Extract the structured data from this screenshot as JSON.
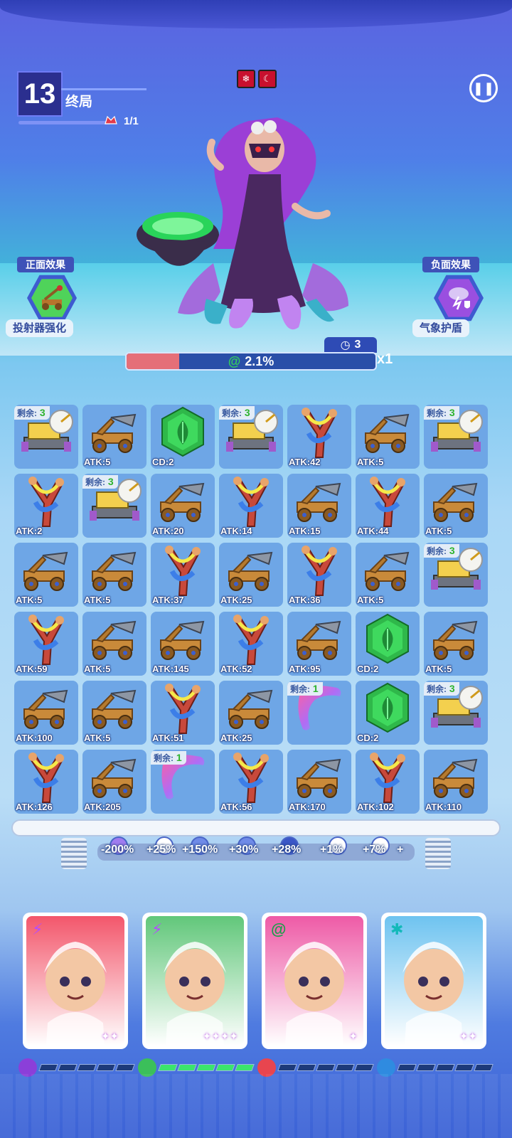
{
  "hud": {
    "level_number": "13",
    "level_title": "终局",
    "wave_text": "1/1",
    "status_icons": [
      "snowflake-icon",
      "sickle-icon"
    ]
  },
  "effects": {
    "positive": {
      "title": "正面效果",
      "label": "投射器强化",
      "icon": "catapult-buff-icon"
    },
    "negative": {
      "title": "负面效果",
      "label": "气象护盾",
      "icon": "storm-shield-icon"
    }
  },
  "boss": {
    "timer": "3",
    "hp_text": "2.1%",
    "hp_fraction": 0.21,
    "multiplier": "x1"
  },
  "grid": [
    [
      {
        "type": "radar",
        "remain": "3"
      },
      {
        "type": "catapult",
        "stat": "ATK:5"
      },
      {
        "type": "gem",
        "stat": "CD:2"
      },
      {
        "type": "radar",
        "remain": "3"
      },
      {
        "type": "slingshot",
        "stat": "ATK:42"
      },
      {
        "type": "catapult",
        "stat": "ATK:5"
      },
      {
        "type": "radar",
        "remain": "3"
      }
    ],
    [
      {
        "type": "slingshot",
        "stat": "ATK:2"
      },
      {
        "type": "radar",
        "remain": "3"
      },
      {
        "type": "catapult",
        "stat": "ATK:20"
      },
      {
        "type": "slingshot",
        "stat": "ATK:14"
      },
      {
        "type": "catapult",
        "stat": "ATK:15"
      },
      {
        "type": "slingshot",
        "stat": "ATK:44"
      },
      {
        "type": "catapult",
        "stat": "ATK:5"
      }
    ],
    [
      {
        "type": "catapult",
        "stat": "ATK:5"
      },
      {
        "type": "catapult",
        "stat": "ATK:5"
      },
      {
        "type": "slingshot",
        "stat": "ATK:37"
      },
      {
        "type": "catapult",
        "stat": "ATK:25"
      },
      {
        "type": "slingshot",
        "stat": "ATK:36"
      },
      {
        "type": "catapult",
        "stat": "ATK:5"
      },
      {
        "type": "radar",
        "remain": "3"
      }
    ],
    [
      {
        "type": "slingshot",
        "stat": "ATK:59"
      },
      {
        "type": "catapult",
        "stat": "ATK:5"
      },
      {
        "type": "catapult",
        "stat": "ATK:145"
      },
      {
        "type": "slingshot",
        "stat": "ATK:52"
      },
      {
        "type": "catapult",
        "stat": "ATK:95"
      },
      {
        "type": "gem",
        "stat": "CD:2"
      },
      {
        "type": "catapult",
        "stat": "ATK:5"
      }
    ],
    [
      {
        "type": "catapult",
        "stat": "ATK:100"
      },
      {
        "type": "catapult",
        "stat": "ATK:5"
      },
      {
        "type": "slingshot",
        "stat": "ATK:51"
      },
      {
        "type": "catapult",
        "stat": "ATK:25"
      },
      {
        "type": "boomerang",
        "remain": "1"
      },
      {
        "type": "gem",
        "stat": "CD:2"
      },
      {
        "type": "radar",
        "remain": "3"
      }
    ],
    [
      {
        "type": "slingshot",
        "stat": "ATK:126"
      },
      {
        "type": "catapult",
        "stat": "ATK:205"
      },
      {
        "type": "boomerang",
        "remain": "1"
      },
      {
        "type": "slingshot",
        "stat": "ATK:56"
      },
      {
        "type": "catapult",
        "stat": "ATK:170"
      },
      {
        "type": "slingshot",
        "stat": "ATK:102"
      },
      {
        "type": "catapult",
        "stat": "ATK:110"
      }
    ]
  ],
  "remain_prefix": "剩余:",
  "buffs": [
    "-200%",
    "+25%",
    "+150%",
    "+30%",
    "+28%",
    "+1%",
    "+7%",
    "+"
  ],
  "heroes": [
    {
      "name": "caveman-hero",
      "element": "⚡",
      "element_color": "#b44cff",
      "stars": "✦✦",
      "bg": "#f3566b",
      "energy": 0,
      "head_color": "#8b3fd9"
    },
    {
      "name": "bear-hood-hero",
      "element": "⚡",
      "element_color": "#b44cff",
      "stars": "✦✦✦✦",
      "bg": "#61c77a",
      "energy": 5,
      "head_color": "#3bbf5a"
    },
    {
      "name": "maid-hero",
      "element": "@",
      "element_color": "#1b9e4b",
      "stars": "✦",
      "bg": "#ee5aa6",
      "energy": 0,
      "head_color": "#e8454f"
    },
    {
      "name": "headset-hero",
      "element": "✱",
      "element_color": "#12b9b9",
      "stars": "✦✦",
      "bg": "#6ec3f0",
      "energy": 0,
      "head_color": "#2f8be0"
    }
  ]
}
